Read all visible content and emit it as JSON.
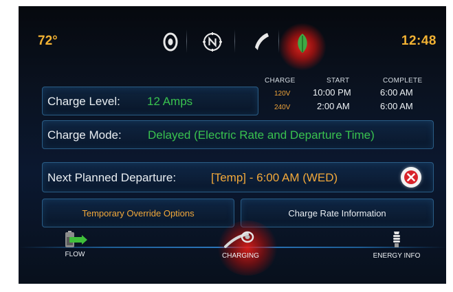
{
  "status": {
    "temperature": "72°",
    "time": "12:48",
    "icons": [
      "audio-icon",
      "navigation-icon",
      "phone-icon",
      "energy-leaf-icon"
    ]
  },
  "charge_level": {
    "label": "Charge Level:",
    "value": "12 Amps"
  },
  "schedule": {
    "headers": {
      "charge": "CHARGE",
      "start": "START",
      "complete": "COMPLETE"
    },
    "rows": [
      {
        "voltage": "120V",
        "start": "10:00 PM",
        "complete": "6:00 AM"
      },
      {
        "voltage": "240V",
        "start": "2:00 AM",
        "complete": "6:00 AM"
      }
    ]
  },
  "charge_mode": {
    "label": "Charge Mode:",
    "value": "Delayed (Electric Rate and Departure Time)"
  },
  "departure": {
    "label": "Next Planned Departure:",
    "value": "[Temp] - 6:00 AM (WED)"
  },
  "buttons": {
    "override": "Temporary Override Options",
    "rate_info": "Charge Rate Information"
  },
  "bottom_nav": {
    "flow": "FLOW",
    "charging": "CHARGING",
    "energy_info": "ENERGY INFO",
    "active": "charging"
  },
  "colors": {
    "accent_orange": "#f2b233",
    "value_green": "#39c24f",
    "panel_border": "#2a5d86",
    "active_glow": "#e61e19"
  }
}
